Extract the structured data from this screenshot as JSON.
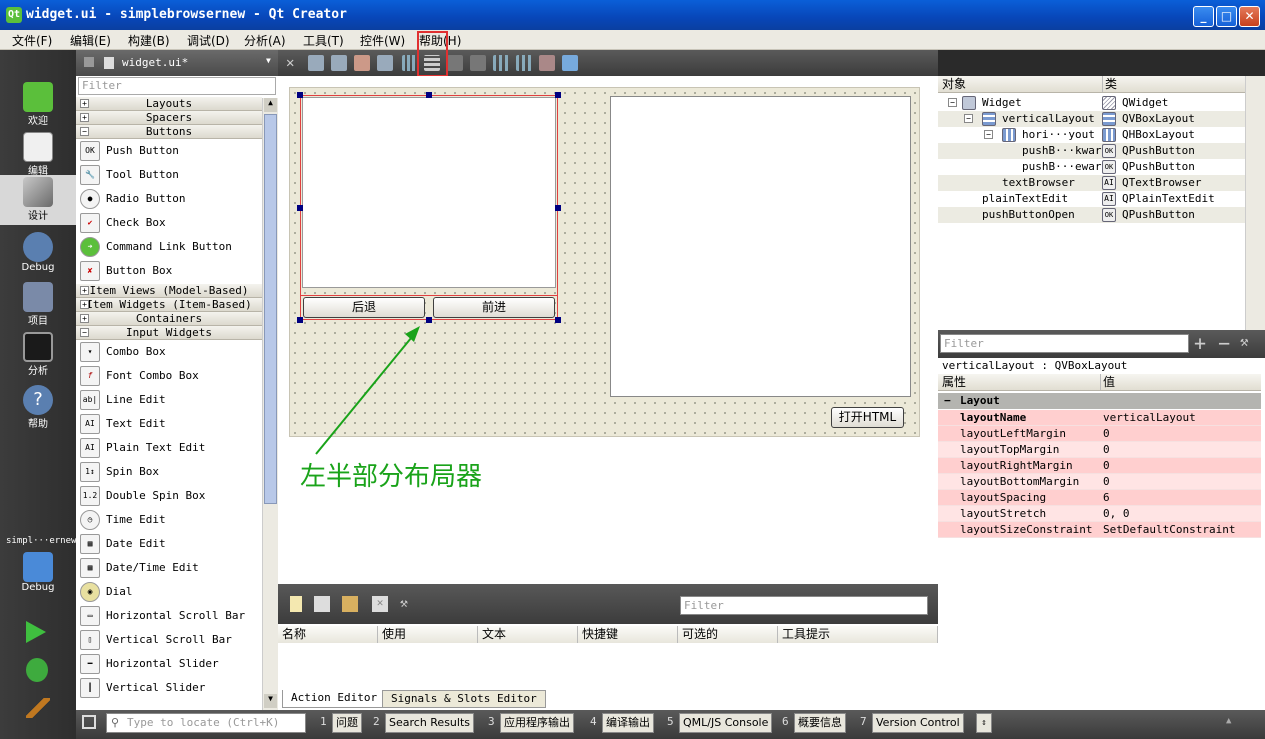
{
  "window": {
    "title": "widget.ui - simplebrowsernew - Qt Creator"
  },
  "menu": [
    "文件(F)",
    "编辑(E)",
    "构建(B)",
    "调试(D)",
    "分析(A)",
    "工具(T)",
    "控件(W)",
    "帮助(H)"
  ],
  "modes": [
    "欢迎",
    "编辑",
    "设计",
    "Debug",
    "项目",
    "分析",
    "帮助"
  ],
  "project": {
    "name": "simpl···ernew",
    "kit": "Debug"
  },
  "editor": {
    "file": "widget.ui*"
  },
  "widget_box": {
    "filter_placeholder": "Filter",
    "categories_top": [
      "Layouts",
      "Spacers",
      "Buttons"
    ],
    "buttons": [
      "Push Button",
      "Tool Button",
      "Radio Button",
      "Check Box",
      "Command Link Button",
      "Button Box"
    ],
    "categories_mid": [
      "Item Views (Model-Based)",
      "Item Widgets (Item-Based)",
      "Containers",
      "Input Widgets"
    ],
    "inputs": [
      "Combo Box",
      "Font Combo Box",
      "Line Edit",
      "Text Edit",
      "Plain Text Edit",
      "Spin Box",
      "Double Spin Box",
      "Time Edit",
      "Date Edit",
      "Date/Time Edit",
      "Dial",
      "Horizontal Scroll Bar",
      "Vertical Scroll Bar",
      "Horizontal Slider",
      "Vertical Slider"
    ]
  },
  "form": {
    "back": "后退",
    "forward": "前进",
    "open_html": "打开HTML"
  },
  "annotation": "左半部分布局器",
  "object_inspector": {
    "headers": [
      "对象",
      "类"
    ],
    "rows": [
      {
        "name": "Widget",
        "class": "QWidget"
      },
      {
        "name": "verticalLayout",
        "class": "QVBoxLayout"
      },
      {
        "name": "hori···yout",
        "class": "QHBoxLayout"
      },
      {
        "name": "pushB···kward",
        "class": "QPushButton"
      },
      {
        "name": "pushB···eward",
        "class": "QPushButton"
      },
      {
        "name": "textBrowser",
        "class": "QTextBrowser"
      },
      {
        "name": "plainTextEdit",
        "class": "QPlainTextEdit"
      },
      {
        "name": "pushButtonOpen",
        "class": "QPushButton"
      }
    ]
  },
  "property_editor": {
    "filter_placeholder": "Filter",
    "title": "verticalLayout : QVBoxLayout",
    "headers": [
      "属性",
      "值"
    ],
    "section": "Layout",
    "rows": [
      {
        "name": "layoutName",
        "value": "verticalLayout"
      },
      {
        "name": "layoutLeftMargin",
        "value": "0"
      },
      {
        "name": "layoutTopMargin",
        "value": "0"
      },
      {
        "name": "layoutRightMargin",
        "value": "0"
      },
      {
        "name": "layoutBottomMargin",
        "value": "0"
      },
      {
        "name": "layoutSpacing",
        "value": "6"
      },
      {
        "name": "layoutStretch",
        "value": "0, 0"
      },
      {
        "name": "layoutSizeConstraint",
        "value": "SetDefaultConstraint"
      }
    ]
  },
  "action_editor": {
    "filter_placeholder": "Filter",
    "columns": [
      "名称",
      "使用",
      "文本",
      "快捷键",
      "可选的",
      "工具提示"
    ],
    "tabs": [
      "Action Editor",
      "Signals & Slots Editor"
    ]
  },
  "statusbar": {
    "locate_placeholder": "Type to locate (Ctrl+K)",
    "panes": [
      {
        "n": "1",
        "label": "问题"
      },
      {
        "n": "2",
        "label": "Search Results"
      },
      {
        "n": "3",
        "label": "应用程序输出"
      },
      {
        "n": "4",
        "label": "编译输出"
      },
      {
        "n": "5",
        "label": "QML/JS Console"
      },
      {
        "n": "6",
        "label": "概要信息"
      },
      {
        "n": "7",
        "label": "Version Control"
      }
    ]
  }
}
